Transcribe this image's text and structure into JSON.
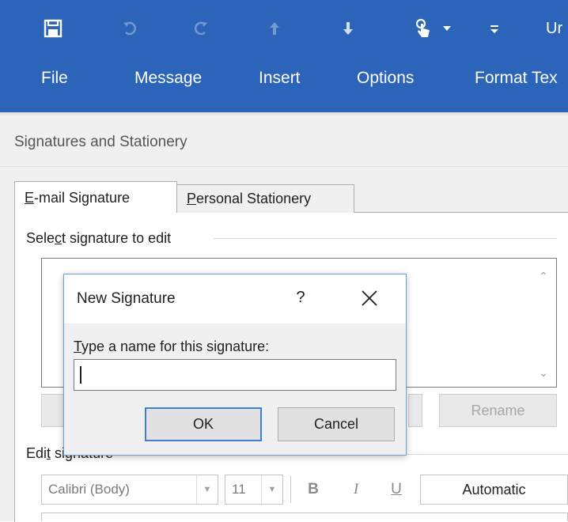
{
  "colors": {
    "ribbon": "#2b64b8",
    "dialog_accent": "#3c7fd4"
  },
  "quick_access": {
    "icons": [
      "save-icon",
      "undo-icon",
      "redo-icon",
      "up-arrow-icon",
      "down-arrow-icon",
      "touch-mode-icon",
      "customize-toolbar-icon"
    ],
    "window_title_fragment": "Ur"
  },
  "menu": {
    "file": "File",
    "message": "Message",
    "insert": "Insert",
    "options": "Options",
    "format_text": "Format Tex"
  },
  "window": {
    "title": "Signatures and Stationery"
  },
  "tabs": {
    "email_signature": {
      "mnemonic": "E",
      "rest": "-mail Signature"
    },
    "personal_stationery": {
      "mnemonic": "P",
      "rest": "ersonal Stationery"
    }
  },
  "select_group": {
    "pre": "Sele",
    "mnemonic": "c",
    "post": "t signature to edit"
  },
  "buttons": {
    "rename": "Rename"
  },
  "edit_group": {
    "pre": "Edi",
    "mnemonic": "t",
    "post": " signature"
  },
  "format": {
    "font": "Calibri (Body)",
    "size": "11",
    "bold": "B",
    "italic": "I",
    "underline": "U",
    "color": "Automatic"
  },
  "dialog": {
    "title": "New Signature",
    "help": "?",
    "prompt_mnemonic": "T",
    "prompt_rest": "ype a name for this signature:",
    "input_value": "",
    "ok": "OK",
    "cancel": "Cancel"
  }
}
